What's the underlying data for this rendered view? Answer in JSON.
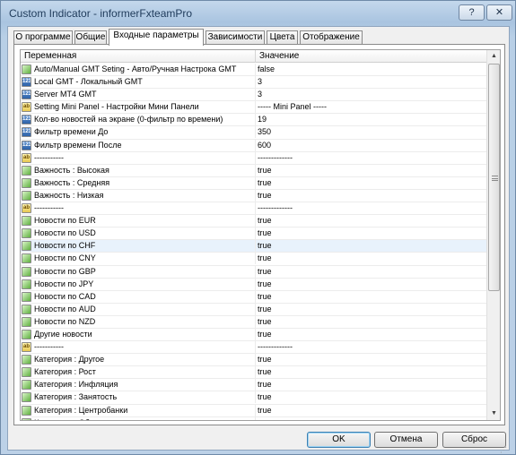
{
  "window": {
    "title": "Custom Indicator - informerFxteamPro",
    "help_label": "?",
    "close_label": "✕"
  },
  "tabs": [
    {
      "label": "О программе"
    },
    {
      "label": "Общие"
    },
    {
      "label": "Входные параметры",
      "active": true
    },
    {
      "label": "Зависимости"
    },
    {
      "label": "Цвета"
    },
    {
      "label": "Отображение"
    }
  ],
  "grid": {
    "col_variable": "Переменная",
    "col_value": "Значение",
    "rows": [
      {
        "icon": "bool-icon",
        "name": "Auto/Manual GMT Seting - Авто/Ручная Настрока GMT",
        "value": "false"
      },
      {
        "icon": "int-icon",
        "name": "Local GMT - Локальный GMT",
        "value": "3"
      },
      {
        "icon": "int-icon",
        "name": "Server MT4 GMT",
        "value": "3"
      },
      {
        "icon": "string-icon",
        "name": "Setting Mini Panel - Настройки Мини Панели",
        "value": "-----  Mini Panel  -----"
      },
      {
        "icon": "int-icon",
        "name": "Кол-во новостей на экране (0-фильтр по времени)",
        "value": "19"
      },
      {
        "icon": "int-icon",
        "name": "Фильтр времени До",
        "value": "350"
      },
      {
        "icon": "int-icon",
        "name": "Фильтр времени После",
        "value": "600"
      },
      {
        "icon": "string-icon",
        "name": "-----------",
        "value": "-------------"
      },
      {
        "icon": "bool-icon",
        "name": "Важность : Высокая",
        "value": "true"
      },
      {
        "icon": "bool-icon",
        "name": "Важность : Средняя",
        "value": "true"
      },
      {
        "icon": "bool-icon",
        "name": "Важность : Низкая",
        "value": "true"
      },
      {
        "icon": "string-icon",
        "name": "-----------",
        "value": "-------------"
      },
      {
        "icon": "bool-icon",
        "name": "Новости по EUR",
        "value": "true"
      },
      {
        "icon": "bool-icon",
        "name": "Новости по USD",
        "value": "true"
      },
      {
        "icon": "bool-icon",
        "name": "Новости по CHF",
        "value": "true",
        "highlight": true
      },
      {
        "icon": "bool-icon",
        "name": "Новости по CNY",
        "value": "true"
      },
      {
        "icon": "bool-icon",
        "name": "Новости по GBP",
        "value": "true"
      },
      {
        "icon": "bool-icon",
        "name": "Новости по JPY",
        "value": "true"
      },
      {
        "icon": "bool-icon",
        "name": "Новости по CAD",
        "value": "true"
      },
      {
        "icon": "bool-icon",
        "name": "Новости по AUD",
        "value": "true"
      },
      {
        "icon": "bool-icon",
        "name": "Новости по NZD",
        "value": "true"
      },
      {
        "icon": "bool-icon",
        "name": "Другие новости",
        "value": "true"
      },
      {
        "icon": "string-icon",
        "name": "-----------",
        "value": "-------------"
      },
      {
        "icon": "bool-icon",
        "name": "Категория : Другое",
        "value": "true"
      },
      {
        "icon": "bool-icon",
        "name": "Категория : Рост",
        "value": "true"
      },
      {
        "icon": "bool-icon",
        "name": "Категория : Инфляция",
        "value": "true"
      },
      {
        "icon": "bool-icon",
        "name": "Категория : Занятость",
        "value": "true"
      },
      {
        "icon": "bool-icon",
        "name": "Категория : Центробанки",
        "value": "true"
      },
      {
        "icon": "bool-icon",
        "name": "Категория : Облигации",
        "value": "true"
      }
    ]
  },
  "icon_glyphs": {
    "int": "123",
    "string": "ab"
  },
  "buttons": {
    "ok_label": "OK",
    "cancel_label": "Отмена",
    "reset_label": "Сброс"
  }
}
